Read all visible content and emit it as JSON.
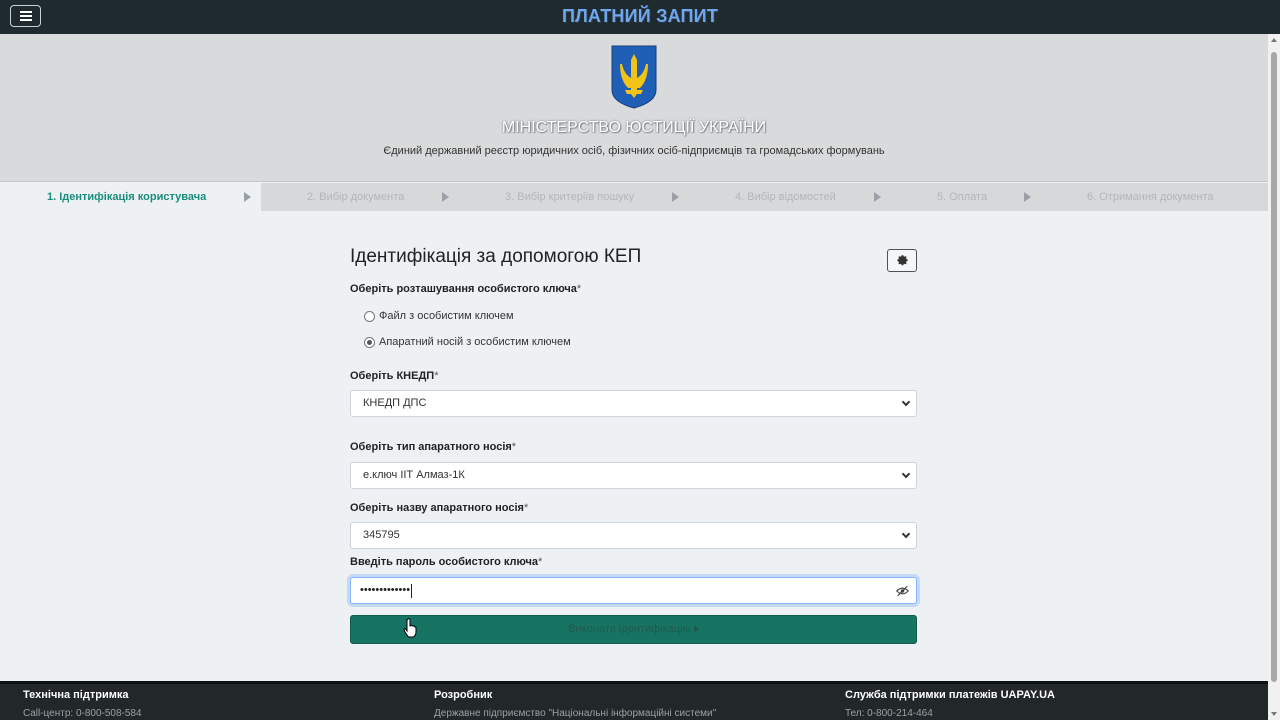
{
  "app": {
    "title": "ПЛАТНИЙ ЗАПИТ"
  },
  "header": {
    "ministry": "МІНІСТЕРСТВО ЮСТИЦІЇ УКРАЇНИ",
    "registry": "Єдиний державний реєстр юридичних осіб, фізичних осіб-підприємців та громадських формувань"
  },
  "steps": [
    {
      "label": "1. Ідентифікація користувача",
      "active": true
    },
    {
      "label": "2. Вибір документа",
      "active": false
    },
    {
      "label": "3. Вибір критеріїв пошуку",
      "active": false
    },
    {
      "label": "4. Вибір відомостей",
      "active": false
    },
    {
      "label": "5. Оплата",
      "active": false
    },
    {
      "label": "6. Отримання документа",
      "active": false
    }
  ],
  "form": {
    "title": "Ідентифікація за допомогою КЕП",
    "key_location_label": "Оберіть розташування особистого ключа",
    "required_mark": "*",
    "key_location_options": [
      {
        "label": "Файл з особистим ключем",
        "checked": false
      },
      {
        "label": "Апаратний носій з особистим ключем",
        "checked": true
      }
    ],
    "kndp_label": "Оберіть КНЕДП",
    "kndp_value": "КНЕДП ДПС",
    "device_type_label": "Оберіть тип апаратного носія",
    "device_type_value": "е.ключ ІІТ Алмаз-1К",
    "device_name_label": "Оберіть назву апаратного носія",
    "device_name_value": "345795",
    "password_label": "Введіть пароль особистого ключа",
    "password_value": "•••••••••••••",
    "submit_label": "Виконати ідентифікацію"
  },
  "footer": {
    "support": {
      "title": "Технічна підтримка",
      "text": "Call-центр: 0-800-508-584"
    },
    "developer": {
      "title": "Розробник",
      "text": "Державне підприємство \"Національні інформаційні системи\""
    },
    "payments": {
      "title": "Служба підтримки платежів UAPAY.UA",
      "text": "Тел: 0-800-214-464"
    }
  },
  "colors": {
    "topbar": "#1f2a2e",
    "title": "#6fa7ee",
    "accent": "#177462",
    "active_step": "#1a8d7c"
  },
  "icons": [
    "menu-icon",
    "coat-of-arms-icon",
    "gear-icon",
    "eye-slash-icon",
    "chevron-right-icon",
    "chevron-down-icon",
    "mouse-pointer-icon"
  ]
}
